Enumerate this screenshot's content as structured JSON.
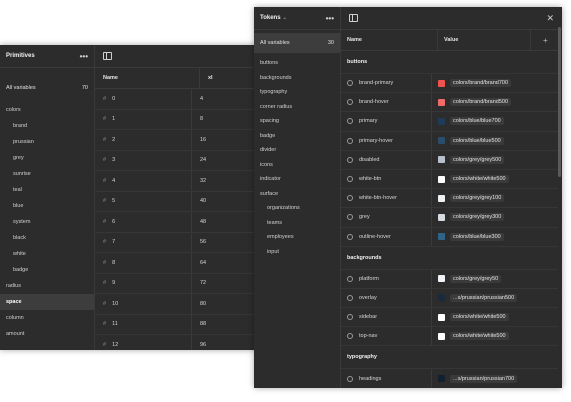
{
  "primitives": {
    "title": "Primitives",
    "all_variables_label": "All variables",
    "all_variables_count": "70",
    "groups": [
      "colors",
      "brand",
      "prussian",
      "grey",
      "sunrise",
      "teal",
      "blue",
      "system",
      "black",
      "white",
      "badge",
      "radius",
      "space",
      "column",
      "amount"
    ],
    "columns": {
      "name": "Name",
      "value": "xl"
    },
    "rows": [
      {
        "name": "0",
        "value": "4"
      },
      {
        "name": "1",
        "value": "8"
      },
      {
        "name": "2",
        "value": "16"
      },
      {
        "name": "3",
        "value": "24"
      },
      {
        "name": "4",
        "value": "32"
      },
      {
        "name": "5",
        "value": "40"
      },
      {
        "name": "6",
        "value": "48"
      },
      {
        "name": "7",
        "value": "56"
      },
      {
        "name": "8",
        "value": "64"
      },
      {
        "name": "9",
        "value": "72"
      },
      {
        "name": "10",
        "value": "80"
      },
      {
        "name": "11",
        "value": "88"
      },
      {
        "name": "12",
        "value": "96"
      }
    ]
  },
  "tokens": {
    "title": "Tokens",
    "all_variables_label": "All variables",
    "all_variables_count": "30",
    "groups": [
      "buttons",
      "backgrounds",
      "typography",
      "corner radius",
      "spacing",
      "badge",
      "divider",
      "icons",
      "indicator",
      "surface",
      "organizations",
      "teams",
      "employees",
      "input"
    ],
    "columns": {
      "name": "Name",
      "value": "Value",
      "add": "+"
    },
    "sections": [
      {
        "title": "buttons",
        "rows": [
          {
            "name": "brand-primary",
            "value": "colors/brand/brand700",
            "swatch": "#ef5350"
          },
          {
            "name": "brand-hover",
            "value": "colors/brand/brand500",
            "swatch": "#f06a6a"
          },
          {
            "name": "primary",
            "value": "colors/blue/blue700",
            "swatch": "#1f3b57"
          },
          {
            "name": "primary-hover",
            "value": "colors/blue/blue500",
            "swatch": "#2a4d6b"
          },
          {
            "name": "disabled",
            "value": "colors/grey/grey500",
            "swatch": "#b8c1cb"
          },
          {
            "name": "white-btn",
            "value": "colors/white/white500",
            "swatch": "#ffffff"
          },
          {
            "name": "white-btn-hover",
            "value": "colors/grey/grey100",
            "swatch": "#eef1f4"
          },
          {
            "name": "grey",
            "value": "colors/grey/grey300",
            "swatch": "#d5dbe1"
          },
          {
            "name": "outline-hover",
            "value": "colors/blue/blue300",
            "swatch": "#2f6488"
          }
        ]
      },
      {
        "title": "backgrounds",
        "rows": [
          {
            "name": "platform",
            "value": "colors/grey/grey50",
            "swatch": "#eef1f5"
          },
          {
            "name": "overlay",
            "value": "...s/prussian/prussian500",
            "swatch": "#1a2a3a"
          },
          {
            "name": "sidebar",
            "value": "colors/white/white500",
            "swatch": "#ffffff"
          },
          {
            "name": "top-nav",
            "value": "colors/white/white500",
            "swatch": "#ffffff"
          }
        ]
      },
      {
        "title": "typography",
        "rows": [
          {
            "name": "headings",
            "value": "...s/prussian/prussian700",
            "swatch": "#13202d"
          },
          {
            "name": "sub-headings",
            "value": "...s/prussian/prussian500",
            "swatch": "#1a2a3a"
          }
        ]
      }
    ]
  }
}
